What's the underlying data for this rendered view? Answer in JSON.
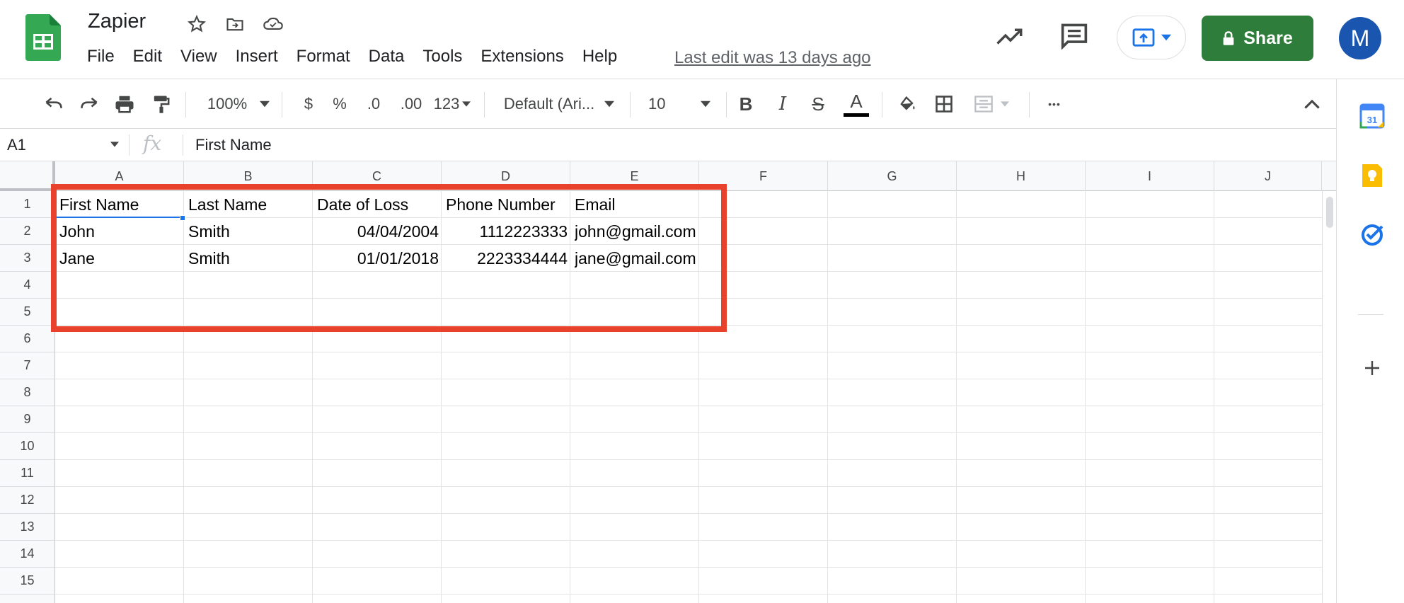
{
  "title": "Zapier",
  "menu": [
    "File",
    "Edit",
    "View",
    "Insert",
    "Format",
    "Data",
    "Tools",
    "Extensions",
    "Help"
  ],
  "last_edit": "Last edit was 13 days ago",
  "share_label": "Share",
  "avatar_letter": "M",
  "toolbar": {
    "zoom": "100%",
    "currency": "$",
    "percent": "%",
    "dec_less": ".0",
    "dec_more": ".00",
    "more_formats": "123",
    "font": "Default (Ari...",
    "font_size": "10",
    "bold": "B",
    "italic": "I",
    "strike": "S",
    "text_color": "A",
    "more": "•••"
  },
  "formula": {
    "namebox": "A1",
    "fx": "fx",
    "value": "First Name"
  },
  "columns": [
    "A",
    "B",
    "C",
    "D",
    "E",
    "F",
    "G",
    "H",
    "I",
    "J"
  ],
  "rows": [
    "1",
    "2",
    "3",
    "4",
    "5",
    "6",
    "7",
    "8",
    "9",
    "10",
    "11",
    "12",
    "13",
    "14",
    "15"
  ],
  "cells": {
    "A1": "First Name",
    "B1": "Last Name",
    "C1": "Date of Loss",
    "D1": "Phone Number",
    "E1": "Email",
    "A2": "John",
    "B2": "Smith",
    "C2": "04/04/2004",
    "D2": "1112223333",
    "E2": "john@gmail.com",
    "A3": "Jane",
    "B3": "Smith",
    "C3": "01/01/2018",
    "D3": "2223334444",
    "E3": "jane@gmail.com"
  },
  "side_panel": {
    "calendar_day": "31"
  },
  "colors": {
    "share": "#2e7d3a",
    "highlight": "#e8412c",
    "selection": "#1a73e8",
    "avatar": "#1a56b0"
  }
}
